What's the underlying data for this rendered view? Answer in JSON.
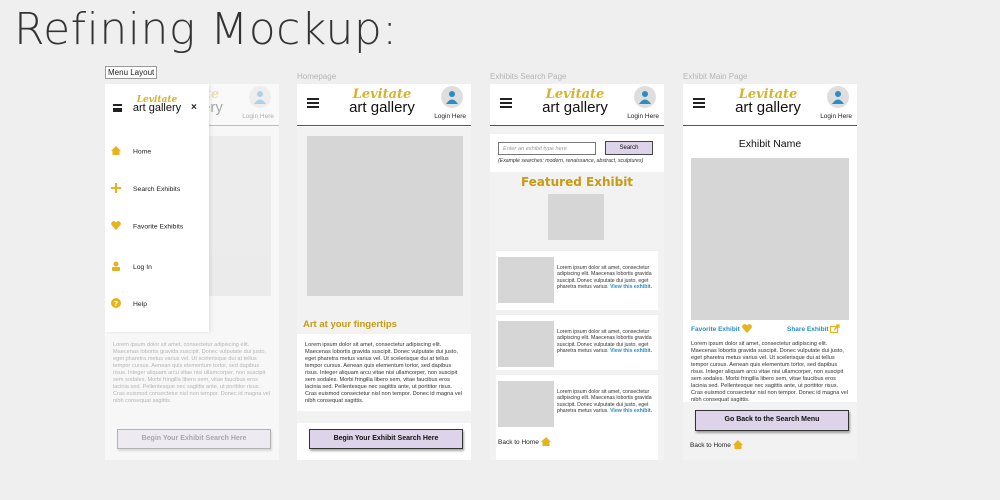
{
  "page_title": "Refining Mockup:",
  "brand": {
    "script": "Levitate",
    "main": "art gallery",
    "gold": "#d8b32a",
    "accent_purple": "#ddd4ea",
    "link_blue": "#2a8dc4"
  },
  "header": {
    "login": "Login Here",
    "avatar_icon": "user-icon",
    "menu_icon": "hamburger-icon"
  },
  "frames": {
    "menu_layout": {
      "label": "Menu Layout",
      "close": "×",
      "items": [
        {
          "label": "Home",
          "icon": "home-icon"
        },
        {
          "label": "Search Exhibits",
          "icon": "plus-icon"
        },
        {
          "label": "Favorite Exhibits",
          "icon": "heart-icon"
        },
        {
          "label": "Log In",
          "icon": "user-icon"
        },
        {
          "label": "Help",
          "icon": "help-icon"
        }
      ],
      "lorem": "Lorem ipsum dolor sit amet, consectetur adipiscing elit. Maecenas lobortis gravida suscipit. Donec vulputate dui justo, eget pharetra metus varius vel. Ut scelerisque dui at tellus tempor cursus. Aenean quis elementum tortor, sed dapibus risus. Integer aliquam arcu vitae nisi ullamcorper, non suscipit sem sodales. Morbi fringilla libero sem, vitae faucibus eros lacinia sed. Pellentesque nec sagittis ante, ut porttitor risus. Cras euismod consectetur nisl non tempor. Donec id magna vel nibh consequat sagittis.",
      "cta": "Begin Your Exhibit Search Here"
    },
    "homepage": {
      "label": "Homepage",
      "heading": "Art at your fingertips",
      "lorem": "Lorem ipsum dolor sit amet, consectetur adipiscing elit. Maecenas lobortis gravida suscipit. Donec vulputate dui justo, eget pharetra metus varius vel. Ut scelerisque dui at tellus tempor cursus. Aenean quis elementum tortor, sed dapibus risus. Integer aliquam arcu vitae nisi ullamcorper, non suscipit sem sodales. Morbi fringilla libero sem, vitae faucibus eros lacinia sed. Pellentesque nec sagittis ante, ut porttitor risus. Cras euismod consectetur nisl non tempor. Donec id magna vel nibh consequat sagittis.",
      "cta": "Begin Your Exhibit Search Here"
    },
    "search_page": {
      "label": "Exhibits Search Page",
      "search_placeholder": "Enter an exhibit type here",
      "search_button": "Search",
      "examples": "(Example searches: modern, renaissance, abstract, sculptures)",
      "featured": "Featured Exhibit",
      "card_text": "Lorem ipsum dolor sit amet, consectetur adipiscing elit. Maecenas lobortis gravida suscipit. Donec vulputate dui justo, eget pharetra metus varius.",
      "view_link": "View this exhibit.",
      "back_home": "Back to Home"
    },
    "exhibit_page": {
      "label": "Exhibit Main Page",
      "exhibit_name": "Exhibit Name",
      "favorite": "Favorite Exhibit",
      "share": "Share Exhibit",
      "lorem": "Lorem ipsum dolor sit amet, consectetur adipiscing elit. Maecenas lobortis gravida suscipit. Donec vulputate dui justo, eget pharetra metus varius vel. Ut scelerisque dui at tellus tempor cursus. Aenean quis elementum tortor, sed dapibus risus. Integer aliquam arcu vitae nisi ullamcorper, non suscipit sem sodales. Morbi fringilla libero sem, vitae faucibus eros lacinia sed. Pellentesque nec sagittis ante, ut porttitor risus. Cras euismod consectetur nisl non tempor. Donec id magna vel nibh consequat sagittis.",
      "cta": "Go Back to the Search Menu",
      "back_home": "Back to Home"
    }
  }
}
